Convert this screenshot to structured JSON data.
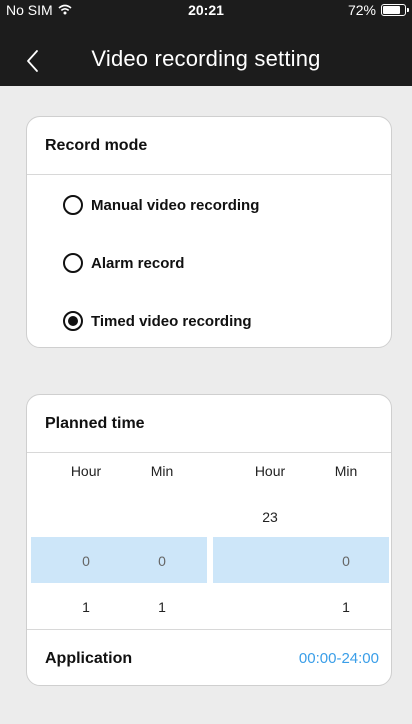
{
  "status_bar": {
    "carrier": "No SIM",
    "time": "20:21",
    "battery": "72%",
    "battery_level": 0.72
  },
  "nav": {
    "back_icon": "chevron-left-icon",
    "title": "Video recording setting"
  },
  "record_mode": {
    "title": "Record mode",
    "options": [
      {
        "label": "Manual video recording",
        "checked": false
      },
      {
        "label": "Alarm record",
        "checked": false
      },
      {
        "label": "Timed video recording",
        "checked": true
      }
    ]
  },
  "planned_time": {
    "title": "Planned time",
    "columns": [
      "Hour",
      "Min",
      "Hour",
      "Min"
    ],
    "rows": [
      [
        "",
        "",
        "23",
        ""
      ],
      [
        "0",
        "0",
        "",
        "0"
      ],
      [
        "1",
        "1",
        "",
        "1"
      ]
    ],
    "selected_row": 1,
    "application_label": "Application",
    "application_value": "00:00-24:00"
  },
  "colors": {
    "topbar": "#1c1c1c",
    "background": "#ececec",
    "selection_band": "#cde6f9",
    "link": "#3a9ee8"
  }
}
